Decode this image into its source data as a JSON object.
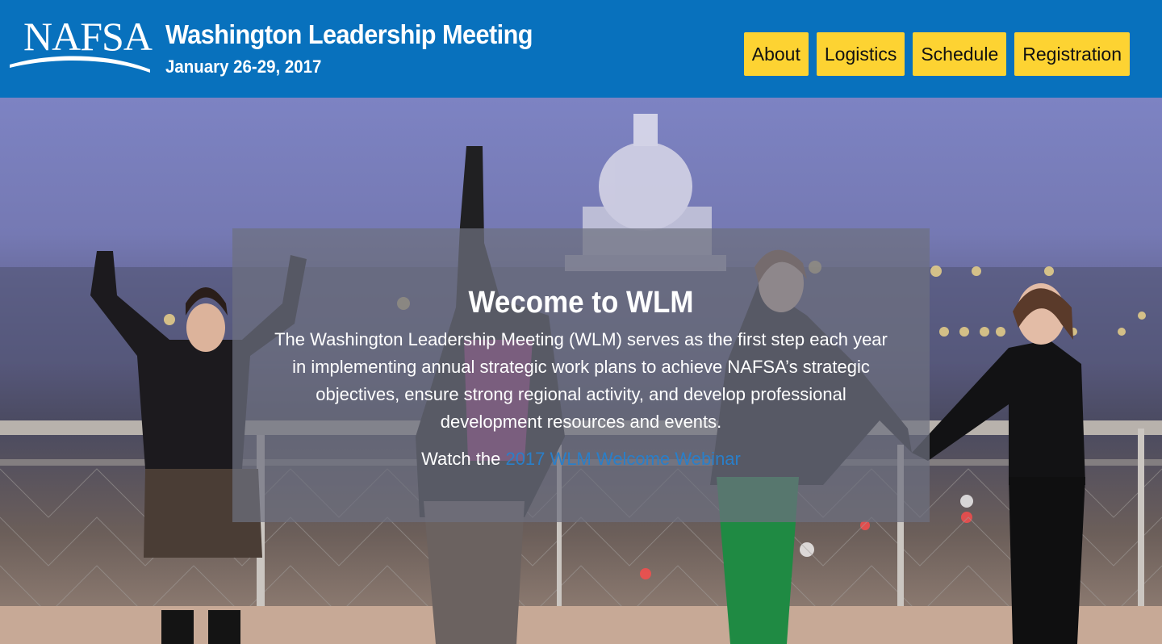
{
  "header": {
    "logo_text": "NAFSA",
    "title": "Washington Leadership Meeting",
    "dates": "January 26-29, 2017",
    "colors": {
      "background": "#0871bd",
      "nav_button": "#fdd332"
    }
  },
  "nav": {
    "about": "About",
    "logistics": "Logistics",
    "schedule": "Schedule",
    "registration": "Registration"
  },
  "hero": {
    "image_icon": "capitol-rooftop-photo",
    "heading": "Wecome to WLM",
    "body": "The Washington Leadership Meeting (WLM) serves as the first step each year in implementing annual strategic work plans to achieve NAFSA’s strategic objectives, ensure strong regional activity, and develop professional development resources and events.",
    "watch_prefix": "Watch the ",
    "webinar_link": "2017 WLM Welcome Webinar",
    "link_color": "#2a7fc9"
  }
}
